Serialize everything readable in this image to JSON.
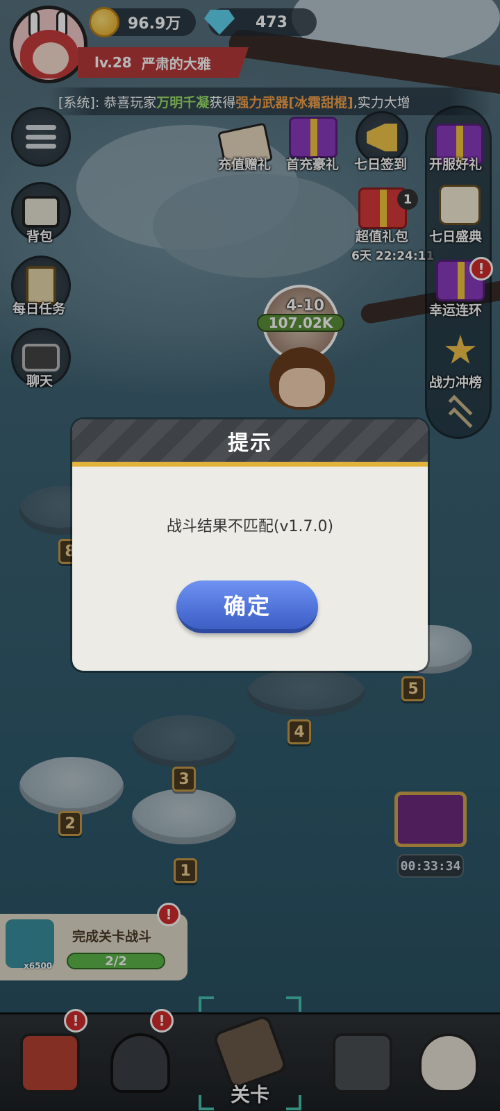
{
  "player": {
    "coins": "96.9万",
    "gems": "473",
    "level": "lv.28",
    "name": "严肃的大雅"
  },
  "ticker": {
    "prefix": "[系统]: 恭喜玩家",
    "player_name": "万明千凝",
    "middle": "获得",
    "item_type": "强力武器",
    "item_name": "[冰霜甜棍]",
    "suffix": ",实力大增"
  },
  "left_menu": {
    "bag": "背包",
    "daily_tasks": "每日任务",
    "chat": "聊天"
  },
  "events": {
    "recharge_gift": "充值赠礼",
    "first_recharge": "首充豪礼",
    "seven_day_signin": "七日签到",
    "value_pack": "超值礼包",
    "value_pack_count": "1",
    "value_pack_timer": "6天 22:24:11"
  },
  "right_menu": {
    "server_open_gift": "开服好礼",
    "seven_day_feast": "七日盛典",
    "lucky_chain": "幸运连环",
    "power_ranking": "战力冲榜",
    "alert": "!"
  },
  "stage": {
    "current": "4-10",
    "power": "107.02K",
    "nodes": [
      "1",
      "2",
      "3",
      "4",
      "5",
      "8"
    ]
  },
  "dialog": {
    "title": "提示",
    "message": "战斗结果不匹配(v1.7.0)",
    "confirm": "确定"
  },
  "quest": {
    "title": "完成关卡战斗",
    "reward_qty": "x6500",
    "progress_text": "2/2",
    "progress": 1.0,
    "alert": "!"
  },
  "chest": {
    "timer": "00:33:34"
  },
  "bottom_nav": {
    "stage_label": "关卡",
    "alert": "!"
  },
  "colors": {
    "dialog_accent": "#e1b33a",
    "confirm_button": "#4f72d8",
    "alert_badge": "#d22c2c",
    "quest_bar": "#5db64b"
  }
}
